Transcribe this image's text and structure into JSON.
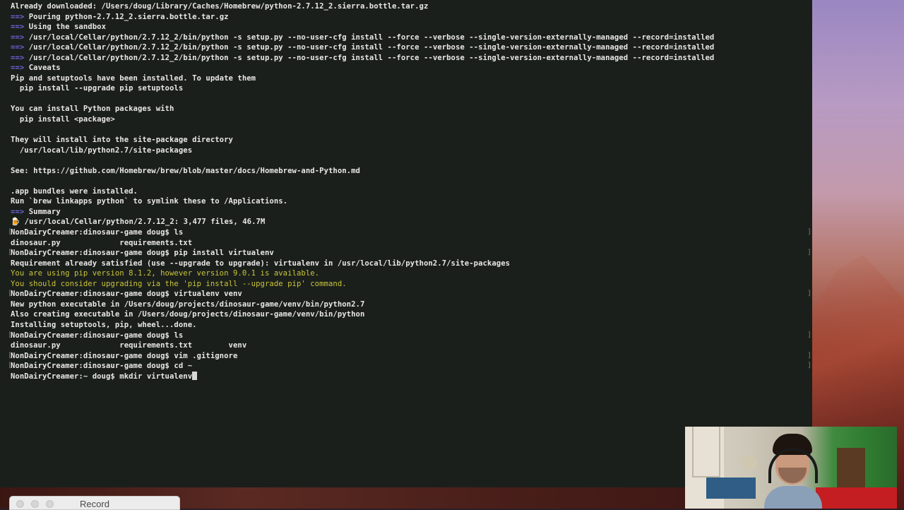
{
  "terminal": {
    "lines": [
      {
        "type": "plain",
        "text": "Already downloaded: /Users/doug/Library/Caches/Homebrew/python-2.7.12_2.sierra.bottle.tar.gz"
      },
      {
        "type": "arrow",
        "text": "Pouring python-2.7.12_2.sierra.bottle.tar.gz"
      },
      {
        "type": "arrow",
        "text": "Using the sandbox"
      },
      {
        "type": "arrow",
        "text": "/usr/local/Cellar/python/2.7.12_2/bin/python -s setup.py --no-user-cfg install --force --verbose --single-version-externally-managed --record=installed"
      },
      {
        "type": "arrow",
        "text": "/usr/local/Cellar/python/2.7.12_2/bin/python -s setup.py --no-user-cfg install --force --verbose --single-version-externally-managed --record=installed"
      },
      {
        "type": "arrow",
        "text": "/usr/local/Cellar/python/2.7.12_2/bin/python -s setup.py --no-user-cfg install --force --verbose --single-version-externally-managed --record=installed"
      },
      {
        "type": "arrow",
        "text": "Caveats"
      },
      {
        "type": "plain",
        "text": "Pip and setuptools have been installed. To update them"
      },
      {
        "type": "plain",
        "text": "  pip install --upgrade pip setuptools"
      },
      {
        "type": "plain",
        "text": ""
      },
      {
        "type": "plain",
        "text": "You can install Python packages with"
      },
      {
        "type": "plain",
        "text": "  pip install <package>"
      },
      {
        "type": "plain",
        "text": ""
      },
      {
        "type": "plain",
        "text": "They will install into the site-package directory"
      },
      {
        "type": "plain",
        "text": "  /usr/local/lib/python2.7/site-packages"
      },
      {
        "type": "plain",
        "text": ""
      },
      {
        "type": "plain",
        "text": "See: https://github.com/Homebrew/brew/blob/master/docs/Homebrew-and-Python.md"
      },
      {
        "type": "plain",
        "text": ""
      },
      {
        "type": "plain",
        "text": ".app bundles were installed."
      },
      {
        "type": "plain",
        "text": "Run `brew linkapps python` to symlink these to /Applications."
      },
      {
        "type": "arrow",
        "text": "Summary"
      },
      {
        "type": "beer",
        "text": "/usr/local/Cellar/python/2.7.12_2: 3,477 files, 46.7M"
      },
      {
        "type": "prompt",
        "text": "NonDairyCreamer:dinosaur-game doug$ ls"
      },
      {
        "type": "plain",
        "text": "dinosaur.py             requirements.txt"
      },
      {
        "type": "prompt",
        "text": "NonDairyCreamer:dinosaur-game doug$ pip install virtualenv"
      },
      {
        "type": "plain",
        "text": "Requirement already satisfied (use --upgrade to upgrade): virtualenv in /usr/local/lib/python2.7/site-packages"
      },
      {
        "type": "yellow",
        "text": "You are using pip version 8.1.2, however version 9.0.1 is available."
      },
      {
        "type": "yellow",
        "text": "You should consider upgrading via the 'pip install --upgrade pip' command."
      },
      {
        "type": "prompt",
        "text": "NonDairyCreamer:dinosaur-game doug$ virtualenv venv"
      },
      {
        "type": "plain",
        "text": "New python executable in /Users/doug/projects/dinosaur-game/venv/bin/python2.7"
      },
      {
        "type": "plain",
        "text": "Also creating executable in /Users/doug/projects/dinosaur-game/venv/bin/python"
      },
      {
        "type": "plain",
        "text": "Installing setuptools, pip, wheel...done."
      },
      {
        "type": "prompt",
        "text": "NonDairyCreamer:dinosaur-game doug$ ls"
      },
      {
        "type": "plain",
        "text": "dinosaur.py             requirements.txt        venv"
      },
      {
        "type": "prompt",
        "text": "NonDairyCreamer:dinosaur-game doug$ vim .gitignore"
      },
      {
        "type": "prompt",
        "text": "NonDairyCreamer:dinosaur-game doug$ cd ~"
      },
      {
        "type": "current",
        "text": "NonDairyCreamer:~ doug$ mkdir virtualenv"
      }
    ],
    "arrow_glyph": "==>",
    "beer_glyph": "🍺",
    "colors": {
      "background": "#1b1f1b",
      "text": "#e7e7e7",
      "arrow": "#6c64d8",
      "warning": "#c9c43a"
    }
  },
  "record_window": {
    "title": "Record"
  },
  "webcam": {
    "label": ""
  }
}
